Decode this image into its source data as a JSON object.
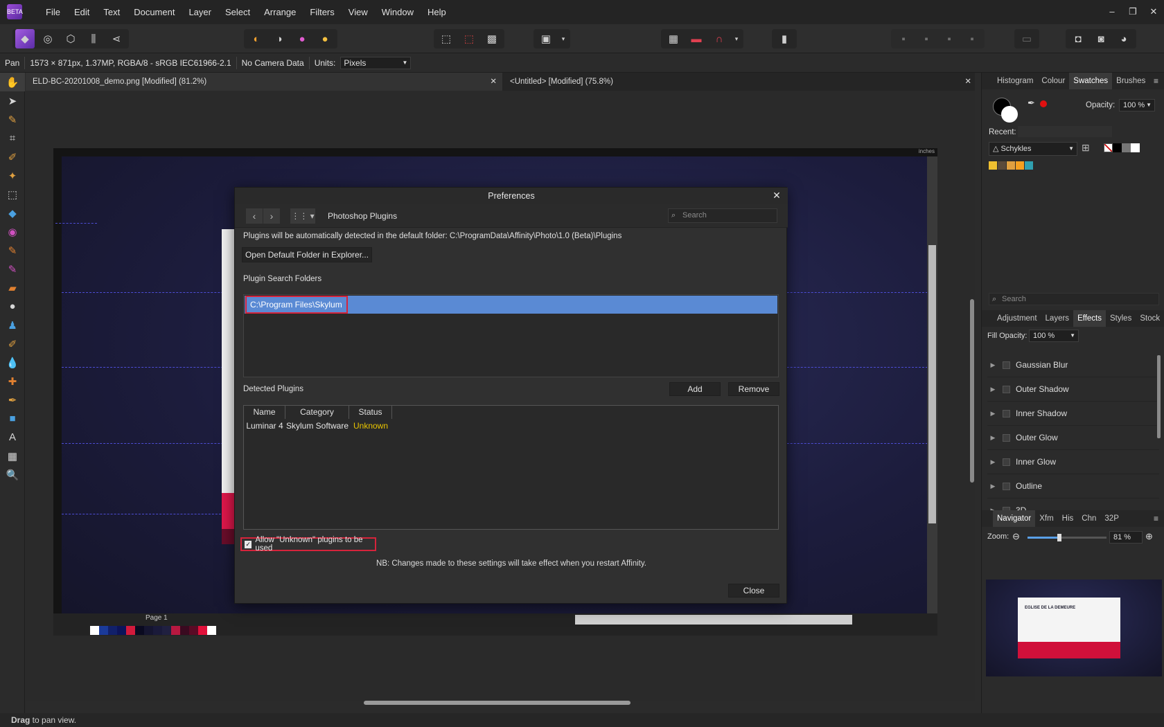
{
  "app": {
    "logo_text": "BETA",
    "menu": [
      "File",
      "Edit",
      "Text",
      "Document",
      "Layer",
      "Select",
      "Arrange",
      "Filters",
      "View",
      "Window",
      "Help"
    ],
    "window_controls": [
      "–",
      "❐",
      "✕"
    ]
  },
  "context_bar": {
    "tool": "Pan",
    "image_info": "1573 × 871px, 1.37MP, RGBA/8 - sRGB IEC61966-2.1",
    "camera": "No Camera Data",
    "units_label": "Units:",
    "units_value": "Pixels"
  },
  "doc_tabs": [
    {
      "title": "ELD-BC-20201008_demo.png [Modified] (81.2%)"
    },
    {
      "title": "<Untitled> [Modified] (75.8%)"
    }
  ],
  "canvas": {
    "ruler_unit": "inches",
    "page_label": "Page 1"
  },
  "preferences": {
    "title": "Preferences",
    "section": "Photoshop Plugins",
    "search_placeholder": "Search",
    "default_folder_text": "Plugins will be automatically detected in the default folder: C:\\ProgramData\\Affinity\\Photo\\1.0 (Beta)\\Plugins",
    "open_folder_button": "Open Default Folder in Explorer...",
    "search_folders_label": "Plugin Search Folders",
    "search_folders": [
      "C:\\Program Files\\Skylum"
    ],
    "detected_label": "Detected Plugins",
    "add_button": "Add",
    "remove_button": "Remove",
    "table_headers": [
      "Name",
      "Category",
      "Status"
    ],
    "plugins": [
      {
        "name": "Luminar 4",
        "category": "Skylum Software",
        "status": "Unknown",
        "status_color": "#e8c400"
      }
    ],
    "allow_unknown_label": "Allow \"Unknown\" plugins to be used",
    "allow_unknown_checked": true,
    "restart_note": "NB: Changes made to these settings will take effect when you restart Affinity.",
    "close_button": "Close"
  },
  "right_panel": {
    "top_tabs": [
      "Histogram",
      "Colour",
      "Swatches",
      "Brushes"
    ],
    "top_active": "Swatches",
    "opacity_label": "Opacity:",
    "opacity_value": "100 %",
    "recent_label": "Recent:",
    "palette_name": "Schykles",
    "search_placeholder": "Search",
    "mid_tabs": [
      "Adjustment",
      "Layers",
      "Effects",
      "Styles",
      "Stock"
    ],
    "mid_active": "Effects",
    "fill_opacity_label": "Fill Opacity:",
    "fill_opacity_value": "100 %",
    "effects": [
      "Gaussian Blur",
      "Outer Shadow",
      "Inner Shadow",
      "Outer Glow",
      "Inner Glow",
      "Outline",
      "3D"
    ],
    "nav_tabs": [
      "Navigator",
      "Xfm",
      "His",
      "Chn",
      "32P"
    ],
    "nav_active": "Navigator",
    "zoom_label": "Zoom:",
    "zoom_value": "81 %",
    "zoom_fraction": 0.4,
    "thumb_title": "EGLISE DE LA DEMEURE"
  },
  "status": {
    "bold": "Drag",
    "rest": " to pan view."
  },
  "colors": {
    "selection_blue": "#5a8ad4",
    "highlight_red": "#d6243b",
    "unknown_yellow": "#e8c400"
  }
}
